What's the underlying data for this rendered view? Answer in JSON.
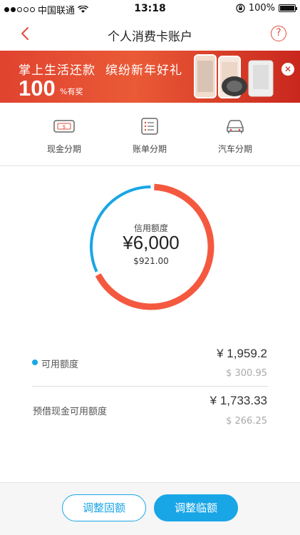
{
  "status_bar": {
    "carrier": "中国联通",
    "time": "13:18",
    "battery": "100%",
    "battery_level": 1.0,
    "signal_bars_filled": 2,
    "signal_bars_total": 5
  },
  "nav": {
    "title": "个人消费卡账户",
    "help_label": "?"
  },
  "banner": {
    "line1_a": "掌上生活还款",
    "line1_b": "缤纷新年好礼",
    "number": "100",
    "sub": "%有奖",
    "close_label": "✕"
  },
  "menu": {
    "items": [
      {
        "label": "现金分期",
        "icon": "cash-icon"
      },
      {
        "label": "账单分期",
        "icon": "bill-list-icon"
      },
      {
        "label": "汽车分期",
        "icon": "car-icon"
      }
    ]
  },
  "credit": {
    "label": "信用额度",
    "amount": "¥6,000",
    "usd": "$921.00",
    "available_fraction": 0.3265
  },
  "rows": [
    {
      "label": "可用额度",
      "amount": "¥ 1,959.2",
      "usd": "$ 300.95"
    },
    {
      "label": "预借现金可用额度",
      "amount": "¥ 1,733.33",
      "usd": "$ 266.25"
    }
  ],
  "buttons": {
    "fixed": "调整固额",
    "temp": "调整临额"
  },
  "colors": {
    "accent_blue": "#19a6e6",
    "accent_red": "#f4593f",
    "brand_red": "#e24b3f"
  }
}
